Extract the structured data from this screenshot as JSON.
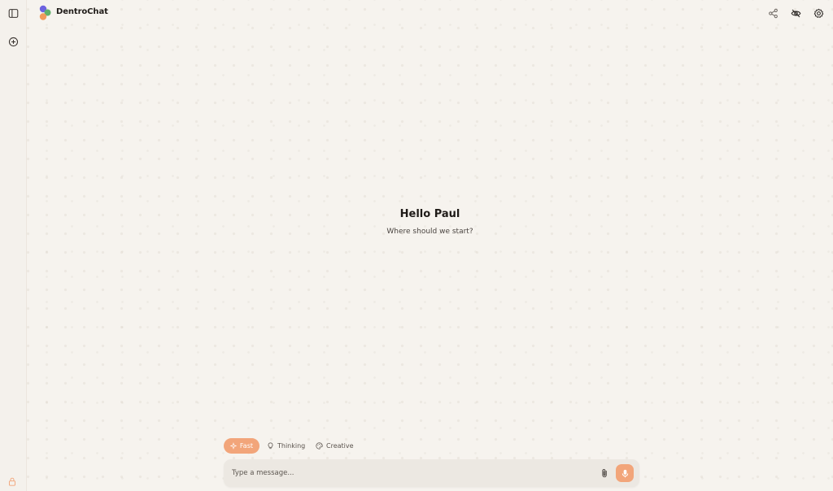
{
  "app": {
    "name": "DentroChat"
  },
  "sidebar": {
    "toggle_icon": "sidebar-toggle-icon",
    "new_chat_icon": "new-chat-icon",
    "lock_icon": "lock-icon"
  },
  "header": {
    "actions": [
      "share-icon",
      "incognito-icon",
      "settings-icon"
    ]
  },
  "main": {
    "greeting": "Hello Paul",
    "subtitle": "Where should we start?"
  },
  "modes": [
    {
      "label": "Fast",
      "icon": "sparkle-icon",
      "active": true
    },
    {
      "label": "Thinking",
      "icon": "lightbulb-icon",
      "active": false
    },
    {
      "label": "Creative",
      "icon": "palette-icon",
      "active": false
    }
  ],
  "composer": {
    "placeholder": "Type a message...",
    "value": "",
    "attach_icon": "paperclip-icon",
    "mic_icon": "microphone-icon"
  },
  "colors": {
    "accent": "#f2a57a",
    "background": "#f6f3ee",
    "logo_purple": "#6d63e0",
    "logo_green": "#5fb06b",
    "logo_orange": "#f29a5c"
  }
}
